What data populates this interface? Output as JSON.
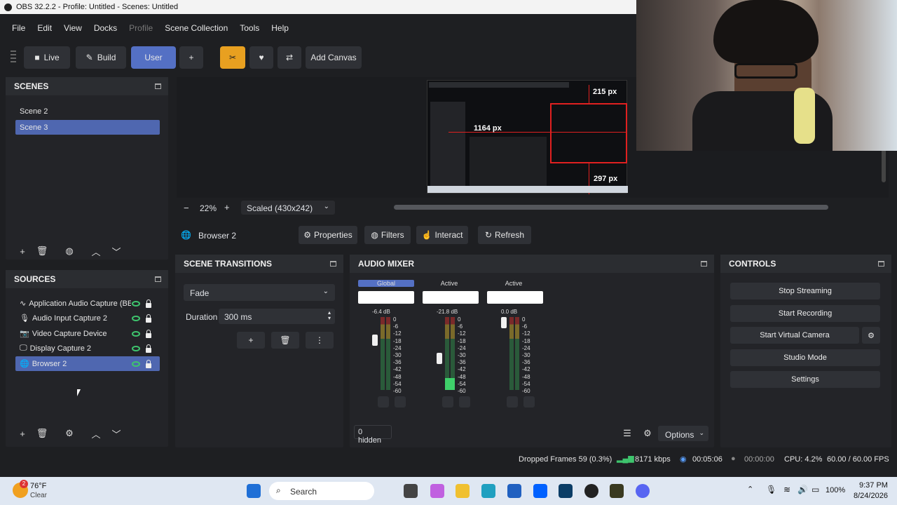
{
  "title": "OBS 32.2.2 - Profile: Untitled - Scenes: Untitled",
  "menu": [
    "File",
    "Edit",
    "View",
    "Docks",
    "Profile",
    "Scene Collection",
    "Tools",
    "Help"
  ],
  "toolbar": {
    "live": "Live",
    "build": "Build",
    "user": "User",
    "plus": "+",
    "add_canvas": "Add Canvas"
  },
  "preview": {
    "label_top": "215 px",
    "label_left": "1164 px",
    "label_bottom": "297 px"
  },
  "zoom": {
    "minus": "−",
    "value": "22%",
    "plus": "+",
    "scale": "Scaled (430x242)"
  },
  "scenes": {
    "title": "SCENES",
    "items": [
      "Scene 2",
      "Scene 3"
    ]
  },
  "sources": {
    "title": "SOURCES",
    "items": [
      "Application Audio Capture (BE",
      "Audio Input Capture 2",
      "Video Capture Device",
      "Display Capture 2",
      "Browser 2"
    ]
  },
  "source_bar": {
    "name": "Browser 2",
    "properties": "Properties",
    "filters": "Filters",
    "interact": "Interact",
    "refresh": "Refresh"
  },
  "transitions": {
    "title": "SCENE TRANSITIONS",
    "type": "Fade",
    "duration_label": "Duration",
    "duration": "300 ms"
  },
  "mixer": {
    "title": "AUDIO MIXER",
    "channels": [
      {
        "label": "Global",
        "db": "-6.4 dB"
      },
      {
        "label": "Active",
        "db": "-21.8 dB"
      },
      {
        "label": "Active",
        "db": "0.0 dB"
      }
    ],
    "ticks": "0\n-6\n-12\n-18\n-24\n-30\n-36\n-42\n-48\n-54\n-60",
    "hidden": "0 hidden",
    "options": "Options"
  },
  "controls": {
    "title": "CONTROLS",
    "stop_streaming": "Stop Streaming",
    "start_recording": "Start Recording",
    "start_virtual_camera": "Start Virtual Camera",
    "studio_mode": "Studio Mode",
    "settings": "Settings"
  },
  "status": {
    "dropped": "Dropped Frames 59 (0.3%)",
    "kbps": "8171 kbps",
    "stream_time": "00:05:06",
    "rec_time": "00:00:00",
    "cpu": "CPU: 4.2%",
    "fps": "60.00 / 60.00 FPS"
  },
  "taskbar": {
    "temp": "76°F",
    "weather": "Clear",
    "badge": "2",
    "search": "Search",
    "battery": "100%",
    "time": "9:37 PM",
    "date": "8/24/2026"
  }
}
